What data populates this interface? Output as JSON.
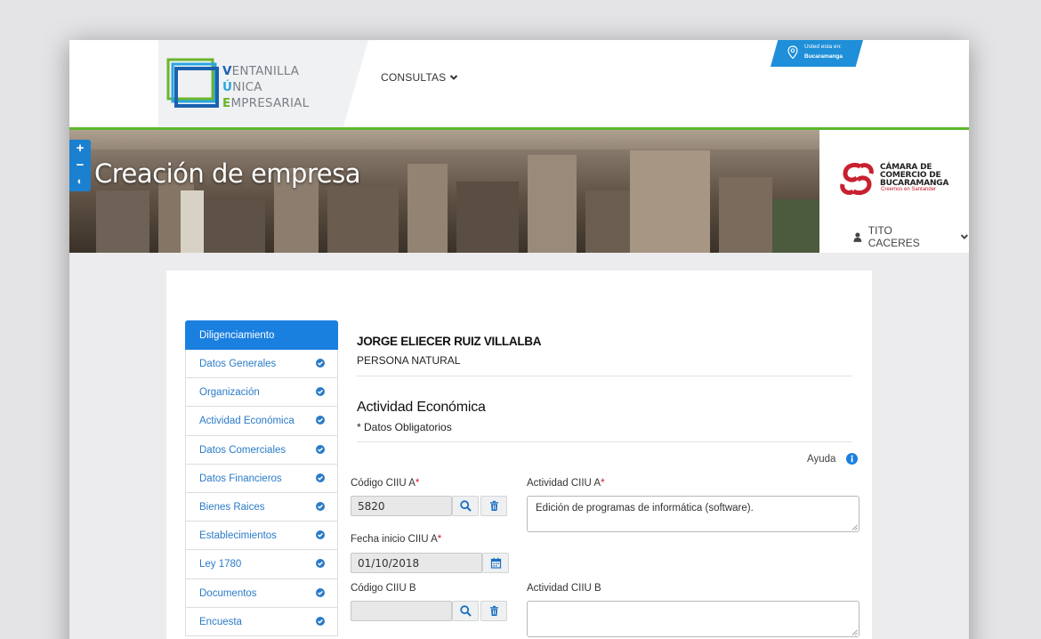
{
  "header": {
    "logo": {
      "line1_initial": "V",
      "line1_rest": "ENTANILLA",
      "line2_initial": "Ú",
      "line2_rest": "NICA",
      "line3_initial": "E",
      "line3_rest": "MPRESARIAL"
    },
    "nav_consultas": "CONSULTAS",
    "location": {
      "title": "Usted esta en:",
      "city": "Bucaramanga"
    }
  },
  "hero": {
    "title": "Creación de empresa"
  },
  "zoom": {
    "plus": "+",
    "minus": "−",
    "contrast": "◐"
  },
  "chamber": {
    "name_line1": "CÁMARA DE",
    "name_line2": "COMERCIO DE",
    "name_line3": "BUCARAMANGA",
    "slogan": "Creemos en Santander"
  },
  "user": {
    "name": "TITO CACERES"
  },
  "sidebar": {
    "header": "Diligenciamiento",
    "items": [
      {
        "label": "Datos Generales"
      },
      {
        "label": "Organización"
      },
      {
        "label": "Actividad Económica"
      },
      {
        "label": "Datos Comerciales"
      },
      {
        "label": "Datos Financieros"
      },
      {
        "label": "Bienes Raices"
      },
      {
        "label": "Establecimientos"
      },
      {
        "label": "Ley 1780"
      },
      {
        "label": "Documentos"
      },
      {
        "label": "Encuesta"
      }
    ]
  },
  "main": {
    "person_name": "JORGE ELIECER RUIZ VILLALBA",
    "person_type": "PERSONA NATURAL",
    "section_title": "Actividad Económica",
    "section_subtitle": "* Datos Obligatorios",
    "help": "Ayuda"
  },
  "form": {
    "ciiu_a_label": "Código CIIU A",
    "ciiu_a_value": "5820",
    "activity_a_label": "Actividad CIIU A",
    "activity_a_value": "Edición de programas de informática (software).",
    "date_a_label": "Fecha inicio CIIU A",
    "date_a_value": "01/10/2018",
    "ciiu_b_label": "Código CIIU B",
    "ciiu_b_value": "",
    "activity_b_label": "Actividad CIIU B",
    "activity_b_value": "",
    "required_mark": "*"
  },
  "colors": {
    "primary": "#1a80e0",
    "green": "#5cb82d",
    "required": "#d3162b",
    "chamber_red": "#c8202f"
  }
}
